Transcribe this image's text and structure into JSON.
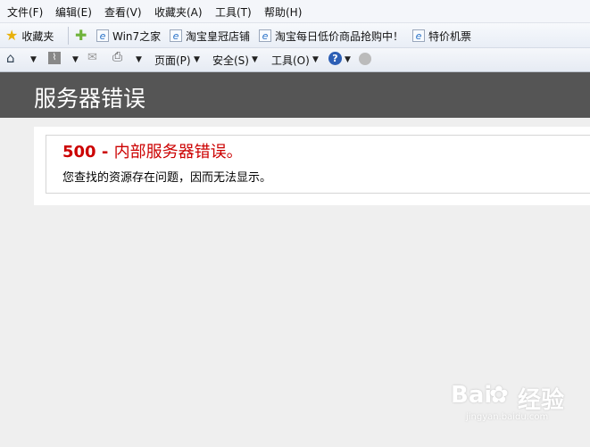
{
  "menu": {
    "file": "文件(F)",
    "edit": "编辑(E)",
    "view": "查看(V)",
    "favorites": "收藏夹(A)",
    "tools": "工具(T)",
    "help": "帮助(H)"
  },
  "favbar": {
    "favorites_label": "收藏夹",
    "links": [
      "Win7之家",
      "淘宝皇冠店铺",
      "淘宝每日低价商品抢购中！",
      "特价机票"
    ]
  },
  "cmdbar": {
    "page": "页面(P)",
    "safety": "安全(S)",
    "tools": "工具(O)"
  },
  "page": {
    "title": "服务器错误",
    "error_code": "500 - ",
    "error_title": "内部服务器错误。",
    "error_message": "您查找的资源存在问题，因而无法显示。"
  },
  "watermark": {
    "brand": "Bai",
    "brand2": "经验",
    "url": "jingyan.baidu.com"
  },
  "colors": {
    "titlebar": "#555555",
    "error_red": "#cc0000",
    "background": "#efefef"
  }
}
